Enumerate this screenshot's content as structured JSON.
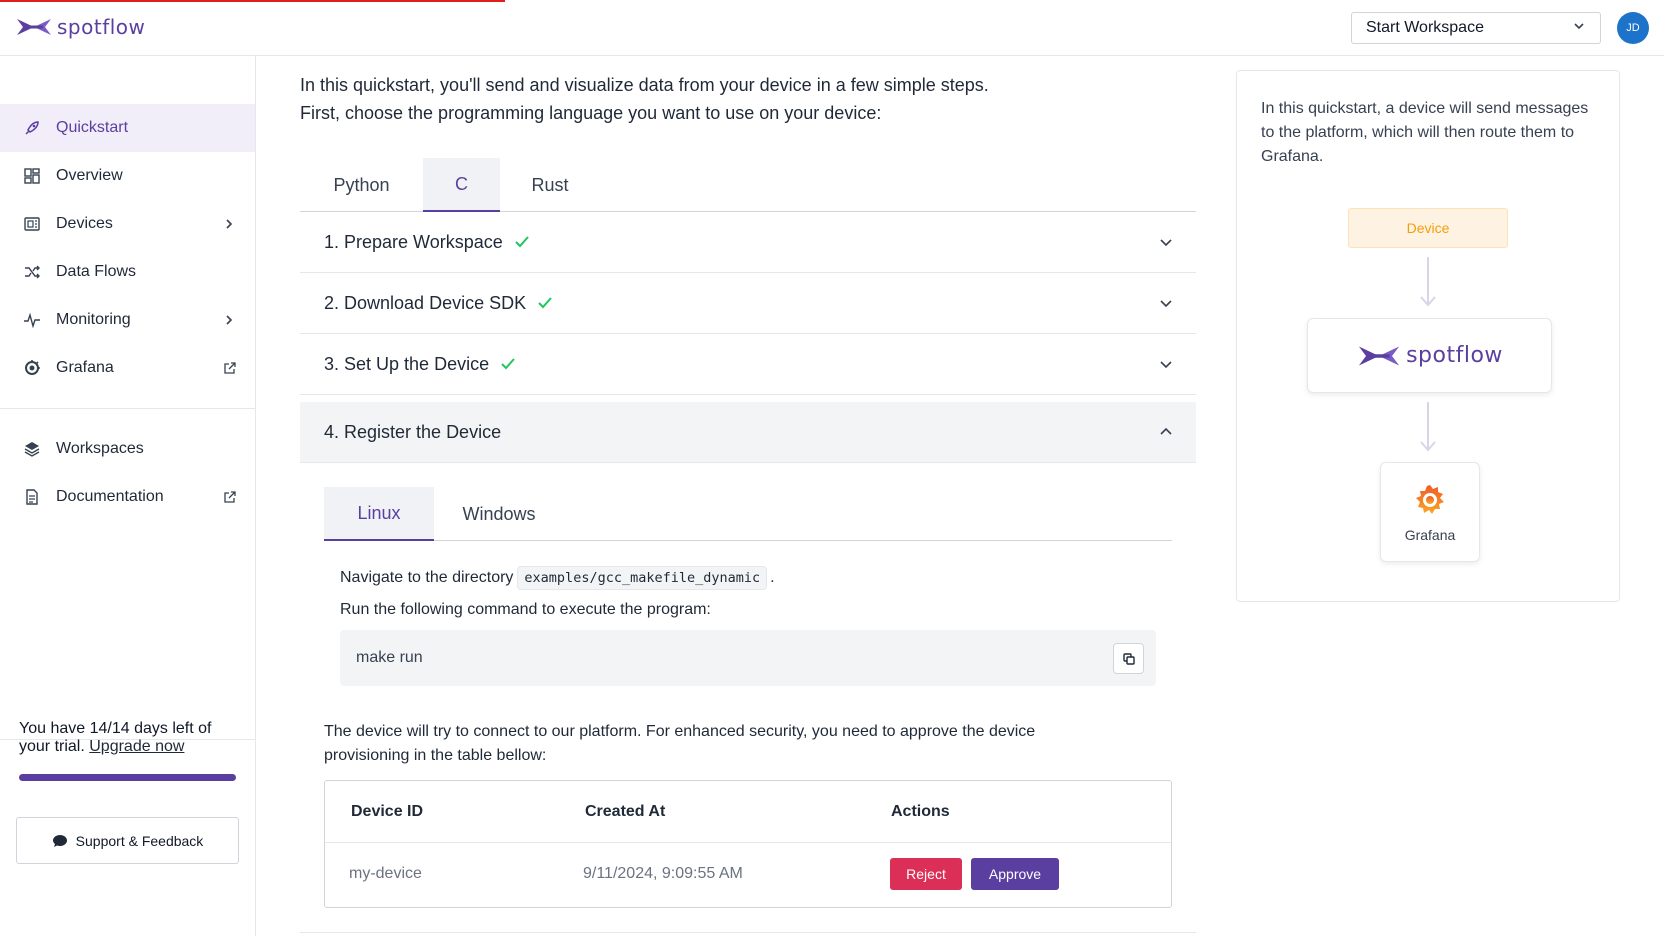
{
  "header": {
    "logo_text": "spotflow",
    "workspace_select": "Start Workspace",
    "avatar_initials": "JD"
  },
  "sidebar": {
    "items": [
      {
        "label": "Quickstart",
        "icon": "rocket-icon",
        "active": true
      },
      {
        "label": "Overview",
        "icon": "grid-icon"
      },
      {
        "label": "Devices",
        "icon": "device-icon",
        "trailing": "chevron-right-icon"
      },
      {
        "label": "Data Flows",
        "icon": "shuffle-icon"
      },
      {
        "label": "Monitoring",
        "icon": "pulse-icon",
        "trailing": "chevron-right-icon"
      },
      {
        "label": "Grafana",
        "icon": "grafana-icon",
        "trailing": "external-link-icon"
      },
      {
        "label": "Workspaces",
        "icon": "layers-icon"
      },
      {
        "label": "Documentation",
        "icon": "document-icon",
        "trailing": "external-link-icon"
      }
    ],
    "trial_text": "You have 14/14 days left of your trial.",
    "upgrade_link": "Upgrade now",
    "support_button": "Support & Feedback"
  },
  "main": {
    "intro_line1": "In this quickstart, you'll send and visualize data from your device in a few simple steps.",
    "intro_line2": "First, choose the programming language you want to use on your device:",
    "lang_tabs": [
      "Python",
      "C",
      "Rust"
    ],
    "active_lang": "C",
    "steps": [
      {
        "label": "1. Prepare Workspace",
        "done": true
      },
      {
        "label": "2. Download Device SDK",
        "done": true
      },
      {
        "label": "3. Set Up the Device",
        "done": true
      },
      {
        "label": "4. Register the Device",
        "done": false,
        "open": true
      }
    ],
    "os_tabs": [
      "Linux",
      "Windows"
    ],
    "active_os": "Linux",
    "navigate_text": "Navigate to the directory",
    "directory": "examples/gcc_makefile_dynamic",
    "period": ".",
    "run_text": "Run the following command to execute the program:",
    "command": "make run",
    "approve_text": "The device will try to connect to our platform. For enhanced security, you need to approve the device provisioning in the table bellow:",
    "table": {
      "headers": [
        "Device ID",
        "Created At",
        "Actions"
      ],
      "rows": [
        {
          "device_id": "my-device",
          "created_at": "9/11/2024, 9:09:55 AM",
          "reject": "Reject",
          "approve": "Approve"
        }
      ]
    }
  },
  "info_panel": {
    "text": "In this quickstart, a device will send messages to the platform, which will then route them to Grafana.",
    "device_label": "Device",
    "platform_label": "spotflow",
    "grafana_label": "Grafana"
  },
  "colors": {
    "brand": "#5b3fa0",
    "reject": "#dc2f57",
    "success": "#22c55e",
    "avatar": "#1d72c9"
  }
}
